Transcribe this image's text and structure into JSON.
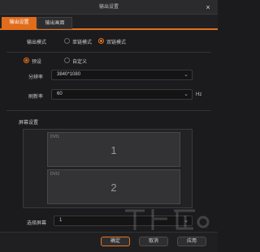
{
  "window": {
    "title": "输出设置",
    "close_symbol": "×"
  },
  "tabs": [
    {
      "label": "输出设置",
      "active": true
    },
    {
      "label": "输出画面",
      "active": false
    }
  ],
  "output_mode": {
    "label": "输出模式",
    "options": [
      {
        "label": "单链模式",
        "selected": false
      },
      {
        "label": "双链模式",
        "selected": true
      }
    ]
  },
  "preset_mode": {
    "options": [
      {
        "label": "预设",
        "selected": true
      },
      {
        "label": "自定义",
        "selected": false
      }
    ]
  },
  "resolution": {
    "label": "分辨率",
    "value": "3840*1080"
  },
  "refresh_rate": {
    "label": "刷新率",
    "value": "60",
    "unit": "Hz"
  },
  "screen_settings": {
    "label": "屏幕设置",
    "monitors": [
      {
        "tag": "DVI1",
        "number": "1"
      },
      {
        "tag": "DVI2",
        "number": "2"
      }
    ]
  },
  "select_screen": {
    "label": "选择屏幕",
    "value": "1"
  },
  "buttons": {
    "ok": "确定",
    "cancel": "取消",
    "apply": "应用"
  },
  "icons": {
    "close": "close-icon",
    "chevron": "chevron-down-icon"
  },
  "colors": {
    "accent": "#e8761e",
    "background": "#1b1b1d"
  }
}
